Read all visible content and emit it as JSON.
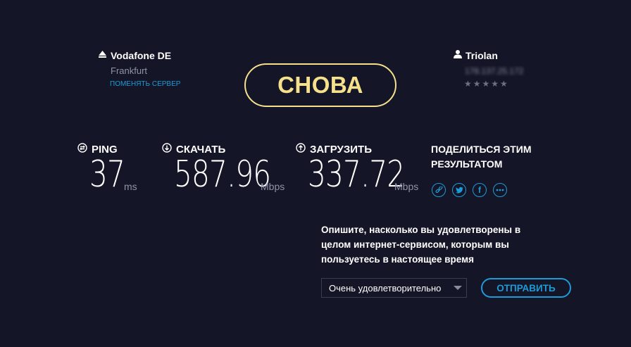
{
  "server": {
    "name": "Vodafone DE",
    "location": "Frankfurt",
    "change_label": "ПОМЕНЯТЬ СЕРВЕР"
  },
  "again_button": "СНОВА",
  "isp": {
    "name": "Triolan",
    "ip": "178.137.25.172",
    "stars": "★★★★★"
  },
  "metrics": {
    "ping": {
      "label": "PING",
      "value": "37",
      "unit": "ms"
    },
    "download": {
      "label": "СКАЧАТЬ",
      "value": "587.96",
      "unit": "Mbps"
    },
    "upload": {
      "label": "ЗАГРУЗИТЬ",
      "value": "337.72",
      "unit": "Mbps"
    }
  },
  "share": {
    "title_line1": "ПОДЕЛИТЬСЯ ЭТИМ",
    "title_line2": "РЕЗУЛЬТАТОМ"
  },
  "survey": {
    "line1": "Опишите, насколько вы удовлетворены в",
    "line2": "целом интернет-сервисом, которым вы",
    "line3": "пользуетесь в настоящее время",
    "selected_option": "Очень удовлетворительно",
    "submit_label": "ОТПРАВИТЬ"
  },
  "colors": {
    "background": "#141526",
    "accent_yellow": "#f5e08b",
    "accent_blue": "#1d9bd8"
  }
}
